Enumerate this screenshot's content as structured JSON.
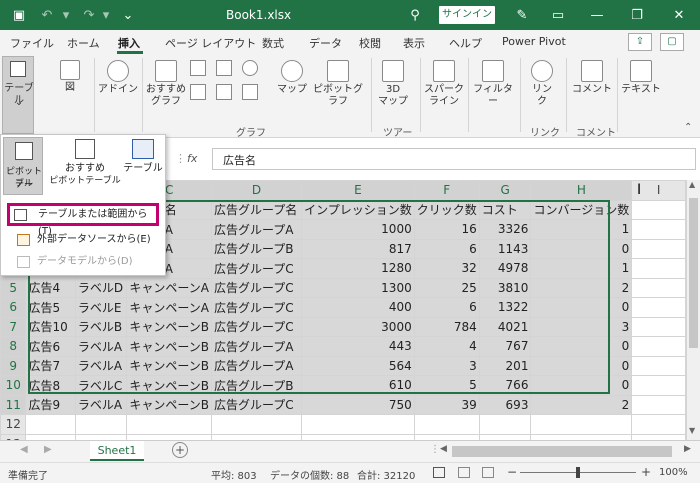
{
  "titlebar": {
    "title": "Book1.xlsx",
    "signin": "サインイン",
    "save_icon": "save-icon",
    "undo_icon": "undo-icon",
    "redo_icon": "redo-icon",
    "minimize": "—",
    "restore": "❐",
    "close": "✕"
  },
  "tabs": [
    "ファイル",
    "ホーム",
    "挿入",
    "ページ レイアウト",
    "数式",
    "データ",
    "校閲",
    "表示",
    "ヘルプ",
    "Power Pivot"
  ],
  "ribbon": {
    "table": "テーブル",
    "illust": "図",
    "addin": "アドイン",
    "recchart": "おすすめ",
    "recchart2": "グラフ",
    "map": "マップ",
    "pivotchart": "ピボットグラフ",
    "map3d": "3D",
    "map3d2": "マップ",
    "sparkline": "スパーク",
    "sparkline2": "ライン",
    "filter": "フィルター",
    "link": "リン",
    "link2": "ク",
    "comment": "コメント",
    "text": "テキスト",
    "grp_chart": "グラフ",
    "grp_tour": "ツアー",
    "grp_link": "リンク",
    "grp_comment": "コメント"
  },
  "popup": {
    "pivot": "ピボットテー",
    "pivot2": "ブル",
    "recpivot": "おすすめ",
    "recpivot2": "ピボットテーブル",
    "table": "テーブル",
    "menu": [
      "テーブルまたは範囲から(T)",
      "外部データソースから(E)",
      "データモデルから(D)"
    ]
  },
  "formulabar": {
    "fx": "fx",
    "content": "広告名"
  },
  "columns": [
    "C",
    "D",
    "E",
    "F",
    "G",
    "H",
    "I"
  ],
  "header_row": [
    "ペーン名",
    "広告グループ名",
    "インプレッション数",
    "クリック数",
    "コスト",
    "コンバージョン数"
  ],
  "rows": [
    {
      "n": "2",
      "a": "",
      "b": "",
      "c": "ペーンA",
      "d": "広告グループA",
      "e": "1000",
      "f": "16",
      "g": "3326",
      "h": "1"
    },
    {
      "n": "3",
      "a": "",
      "b": "",
      "c": "ペーンA",
      "d": "広告グループB",
      "e": "817",
      "f": "6",
      "g": "1143",
      "h": "0"
    },
    {
      "n": "4",
      "a": "",
      "b": "",
      "c": "ペーンA",
      "d": "広告グループC",
      "e": "1280",
      "f": "32",
      "g": "4978",
      "h": "1"
    },
    {
      "n": "5",
      "a": "広告4",
      "b": "ラベルD",
      "c": "キャンペーンA",
      "d": "広告グループC",
      "e": "1300",
      "f": "25",
      "g": "3810",
      "h": "2"
    },
    {
      "n": "6",
      "a": "広告5",
      "b": "ラベルE",
      "c": "キャンペーンA",
      "d": "広告グループC",
      "e": "400",
      "f": "6",
      "g": "1322",
      "h": "0"
    },
    {
      "n": "7",
      "a": "広告10",
      "b": "ラベルB",
      "c": "キャンペーンB",
      "d": "広告グループC",
      "e": "3000",
      "f": "784",
      "g": "4021",
      "h": "3"
    },
    {
      "n": "8",
      "a": "広告6",
      "b": "ラベルA",
      "c": "キャンペーンB",
      "d": "広告グループA",
      "e": "443",
      "f": "4",
      "g": "767",
      "h": "0"
    },
    {
      "n": "9",
      "a": "広告7",
      "b": "ラベルA",
      "c": "キャンペーンB",
      "d": "広告グループA",
      "e": "564",
      "f": "3",
      "g": "201",
      "h": "0"
    },
    {
      "n": "10",
      "a": "広告8",
      "b": "ラベルC",
      "c": "キャンペーンB",
      "d": "広告グループB",
      "e": "610",
      "f": "5",
      "g": "766",
      "h": "0"
    },
    {
      "n": "11",
      "a": "広告9",
      "b": "ラベルA",
      "c": "キャンペーンB",
      "d": "広告グループC",
      "e": "750",
      "f": "39",
      "g": "693",
      "h": "2"
    }
  ],
  "empty_rows": [
    "12",
    "13",
    "14",
    "15"
  ],
  "sheet": {
    "name": "Sheet1",
    "add": "+"
  },
  "status": {
    "ready": "準備完了",
    "avg": "平均: 803",
    "count": "データの個数: 88",
    "sum": "合計: 32120",
    "zoom": "100%"
  }
}
